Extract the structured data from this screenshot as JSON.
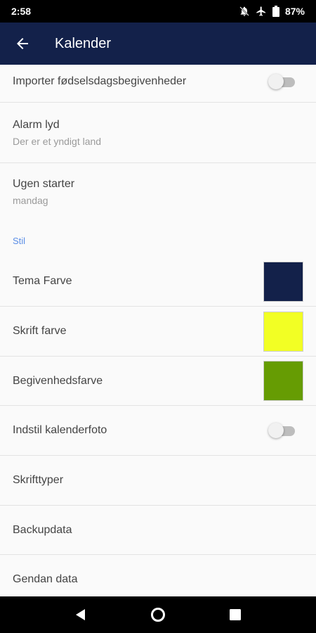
{
  "status_bar": {
    "time": "2:58",
    "battery": "87%",
    "icons": [
      "notifications-off-icon",
      "airplane-icon",
      "battery-icon"
    ]
  },
  "app_bar": {
    "title": "Kalender",
    "back_icon": "arrow-back-icon",
    "background": "#13214a"
  },
  "settings": {
    "import_birthdays": {
      "title": "Importer fødselsdagsbegivenheder",
      "enabled": false
    },
    "alarm_sound": {
      "title": "Alarm lyd",
      "value": "Der er et yndigt land"
    },
    "week_start": {
      "title": "Ugen starter",
      "value": "mandag"
    },
    "style_header": "Stil",
    "theme_color": {
      "title": "Tema Farve",
      "color": "#13214a"
    },
    "font_color": {
      "title": "Skrift farve",
      "color": "#f2ff24"
    },
    "event_color": {
      "title": "Begivenhedsfarve",
      "color": "#669c03"
    },
    "calendar_photo": {
      "title": "Indstil kalenderfoto",
      "enabled": false
    },
    "fonts": {
      "title": "Skrifttyper"
    },
    "backup": {
      "title": "Backupdata"
    },
    "restore": {
      "title": "Gendan data"
    }
  },
  "nav_bar": {
    "buttons": [
      "back-triangle-icon",
      "home-circle-icon",
      "recents-square-icon"
    ]
  },
  "colors": {
    "accent": "#5b8ee6",
    "status_bar": "#000000"
  }
}
